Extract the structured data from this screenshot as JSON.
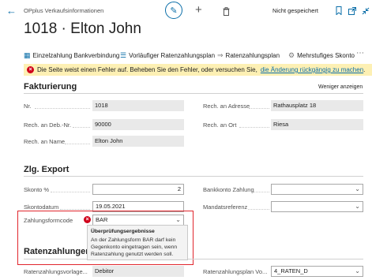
{
  "app": {
    "title": "OPplus Verkaufsinformationen",
    "status": "Nicht gespeichert"
  },
  "page": {
    "title": "1018 · Elton John"
  },
  "actions": [
    {
      "label": "Einzelzahlung Bankverbindung",
      "icon": "table-icon"
    },
    {
      "label": "Vorläufiger Ratenzahlungsplan",
      "icon": "list-icon"
    },
    {
      "label": "Ratenzahlungsplan",
      "icon": "arrow-icon"
    },
    {
      "label": "Mehrstufiges Skonto",
      "icon": "gear-icon"
    }
  ],
  "banner": {
    "text": "Die Seite weist einen Fehler auf. Beheben Sie den Fehler, oder versuchen Sie,",
    "link": "die Änderung rückgängig zu machen",
    "suffix": "."
  },
  "fakturierung": {
    "title": "Fakturierung",
    "less_link": "Weniger anzeigen",
    "nr_label": "Nr.",
    "nr_value": "1018",
    "deb_label": "Rech. an Deb.-Nr.",
    "deb_value": "90000",
    "name_label": "Rech. an Name",
    "name_value": "Elton John",
    "adresse_label": "Rech. an Adresse",
    "adresse_value": "Rathausplatz 18",
    "ort_label": "Rech. an Ort",
    "ort_value": "Riesa"
  },
  "export": {
    "title": "Zlg. Export",
    "skonto_label": "Skonto %",
    "skonto_value": "2",
    "skontodatum_label": "Skontodatum",
    "skontodatum_value": "19.05.2021",
    "zahlungsform_label": "Zahlungsformcode",
    "zahlungsform_value": "BAR",
    "bankkonto_label": "Bankkonto Zahlung",
    "bankkonto_value": "",
    "mandat_label": "Mandatsreferenz",
    "mandat_value": ""
  },
  "tooltip": {
    "title": "Überprüfungsergebnisse",
    "text": "An der Zahlungsform BAR darf kein Gegenkonto eingetragen sein, wenn Ratenzahlung genutzt werden soll."
  },
  "ratenzahlungen": {
    "title": "Ratenzahlungen",
    "vorlage_label": "Ratenzahlungsvorlage...",
    "vorlage_value": "Debitor",
    "plan_label": "Ratenzahlungsplan Vo...",
    "plan_value": "4_RATEN_D"
  },
  "colors": {
    "accent": "#0a6ea8",
    "error": "#d0021b",
    "banner": "#fdf0b4",
    "highlight": "#e1262d"
  }
}
